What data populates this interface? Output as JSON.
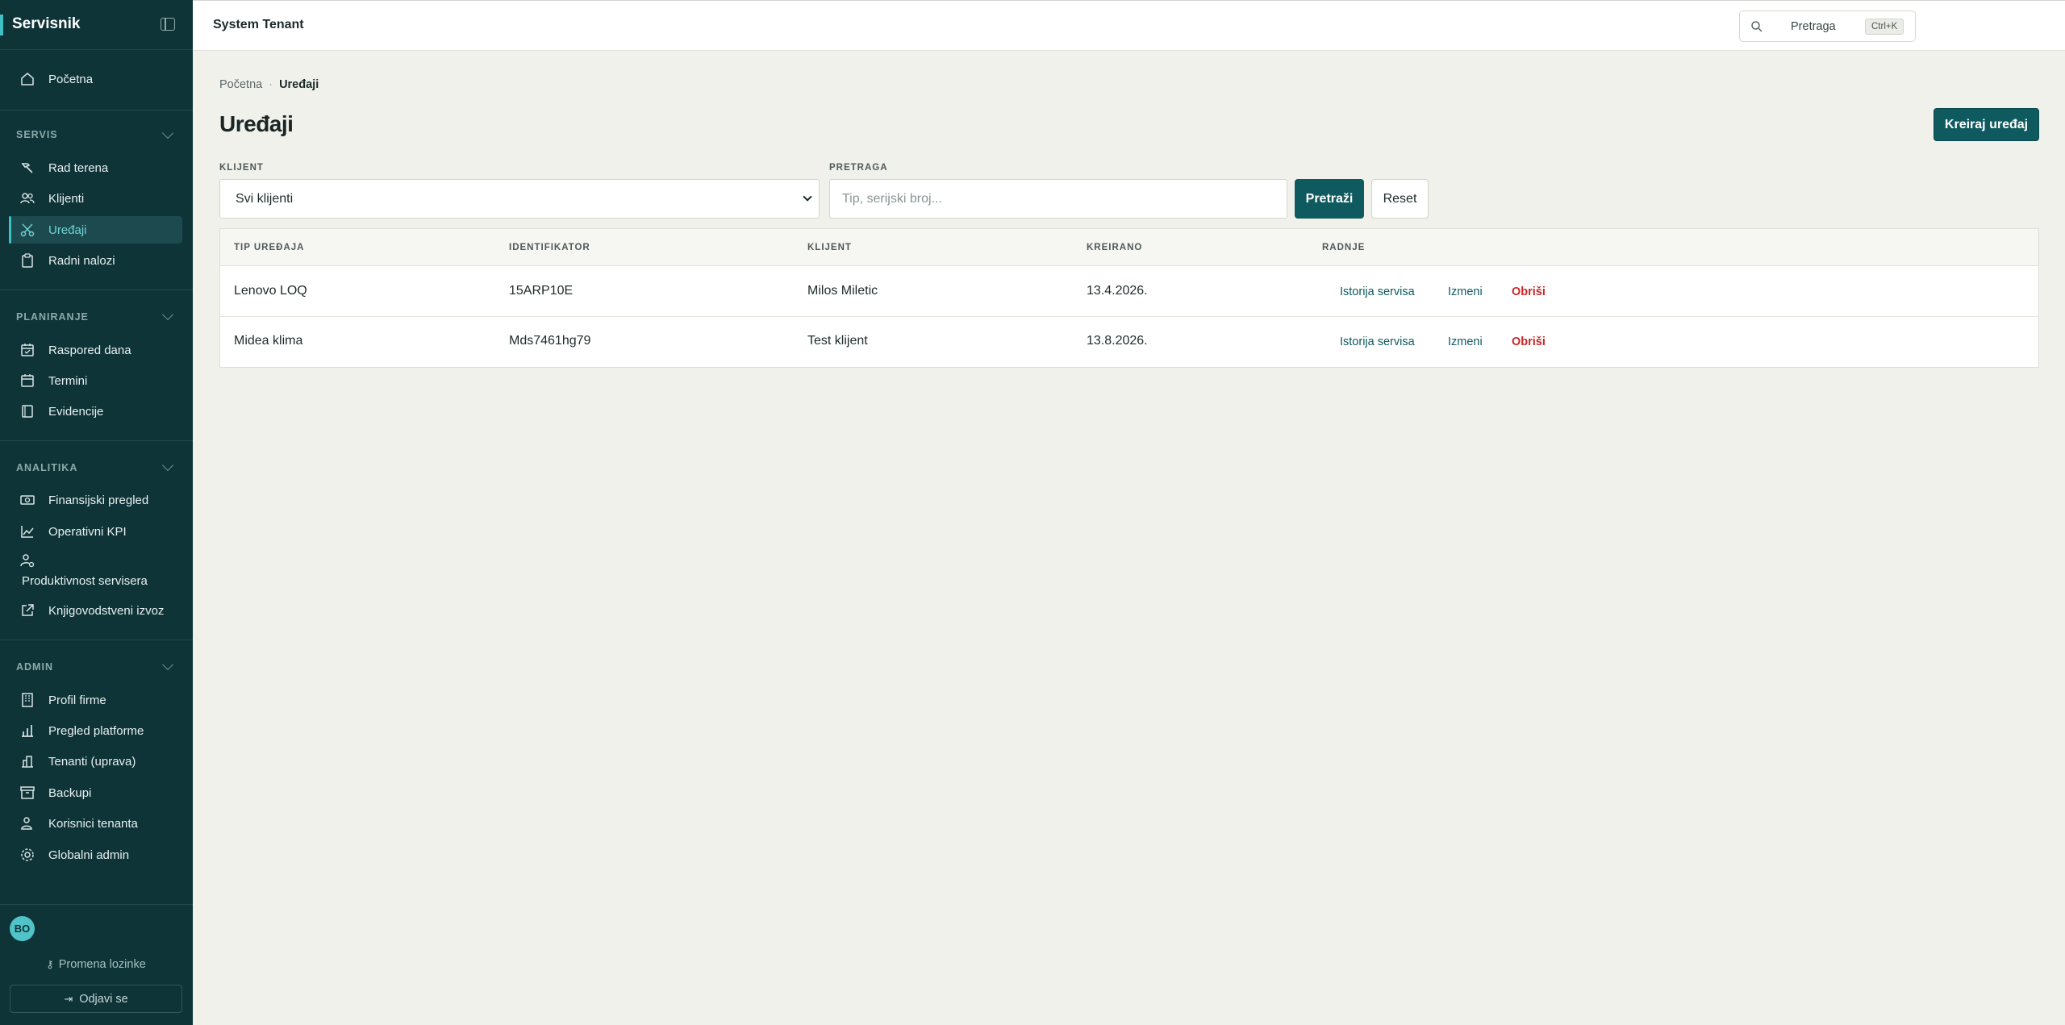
{
  "sidebar": {
    "brand": "Servisnik",
    "home": "Početna",
    "sections": [
      {
        "title": "SERVIS",
        "items": [
          "Rad terena",
          "Klijenti",
          "Uređaji",
          "Radni nalozi"
        ]
      },
      {
        "title": "PLANIRANJE",
        "items": [
          "Raspored dana",
          "Termini",
          "Evidencije"
        ]
      },
      {
        "title": "ANALITIKA",
        "items": [
          "Finansijski pregled",
          "Operativni KPI",
          "Produktivnost servisera",
          "Knjigovodstveni izvoz"
        ]
      },
      {
        "title": "ADMIN",
        "items": [
          "Profil firme",
          "Pregled platforme",
          "Tenanti (uprava)",
          "Backupi",
          "Korisnici tenanta",
          "Globalni admin"
        ]
      }
    ],
    "active_item": "Uređaji",
    "avatar_initials": "BO",
    "change_password": "Promena lozinke",
    "logout": "Odjavi se"
  },
  "topbar": {
    "tenant": "System Tenant",
    "search_label": "Pretraga",
    "shortcut": "Ctrl+K"
  },
  "breadcrumb": {
    "home": "Početna",
    "current": "Uređaji"
  },
  "page": {
    "title": "Uređaji",
    "create_button": "Kreiraj uređaj"
  },
  "filters": {
    "client_label": "KLIJENT",
    "client_value": "Svi klijenti",
    "search_label": "PRETRAGA",
    "search_placeholder": "Tip, serijski broj...",
    "search_button": "Pretraži",
    "reset_button": "Reset"
  },
  "table": {
    "columns": [
      "TIP UREĐAJA",
      "IDENTIFIKATOR",
      "KLIJENT",
      "KREIRANO",
      "RADNJE"
    ],
    "rows": [
      {
        "type": "Lenovo LOQ",
        "id": "15ARP10E",
        "client": "Milos Miletic",
        "created": "13.4.2026."
      },
      {
        "type": "Midea klima",
        "id": "Mds7461hg79",
        "client": "Test klijent",
        "created": "13.8.2026."
      }
    ],
    "actions": {
      "history": "Istorija servisa",
      "edit": "Izmeni",
      "delete": "Obriši"
    }
  }
}
